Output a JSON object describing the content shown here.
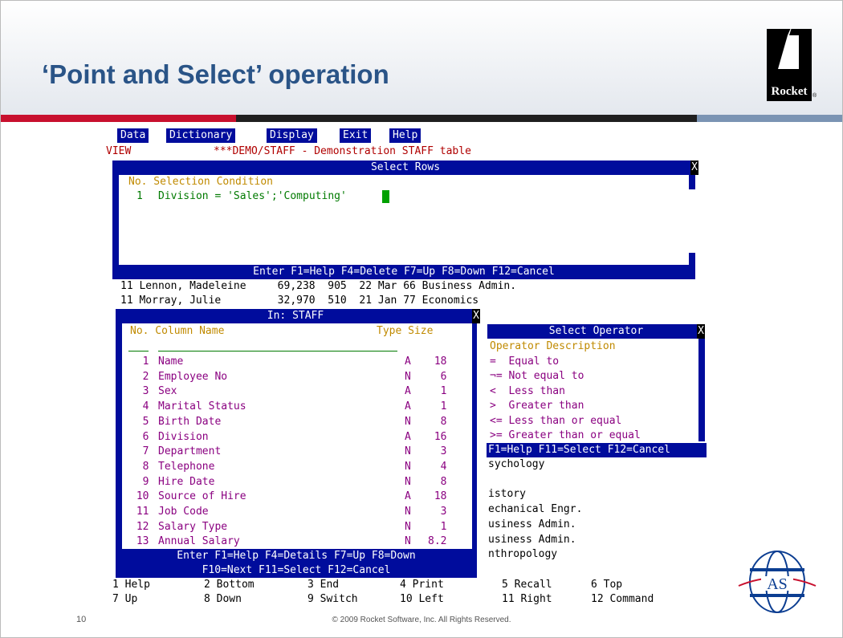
{
  "slide": {
    "title": "‘Point and Select’ operation",
    "page_number": "10",
    "copyright": "© 2009 Rocket Software, Inc. All Rights Reserved.",
    "logo_text": "Rocket",
    "logo_reg": "®",
    "badge_text": "AS"
  },
  "menu": [
    "Data",
    "Dictionary",
    "Display",
    "Exit",
    "Help"
  ],
  "view_label": "VIEW",
  "view_title": "***DEMO/STAFF - Demonstration STAFF table",
  "select_rows": {
    "title": "Select Rows",
    "close": "X",
    "header": "No. Selection Condition",
    "row_num": "1",
    "row_text": "Division = 'Sales';'Computing'",
    "footer": "Enter F1=Help F4=Delete F7=Up F8=Down F12=Cancel"
  },
  "data_rows": [
    "11 Lennon, Madeleine     69,238  905  22 Mar 66 Business Admin.",
    "11 Morray, Julie         32,970  510  21 Jan 77 Economics"
  ],
  "column_picker": {
    "title": "In: STAFF",
    "close": "X",
    "header_no_col": "No. Column Name",
    "header_type_size": "Type Size",
    "rows": [
      {
        "no": "1",
        "name": "Name",
        "type": "A",
        "size": "18"
      },
      {
        "no": "2",
        "name": "Employee No",
        "type": "N",
        "size": "6"
      },
      {
        "no": "3",
        "name": "Sex",
        "type": "A",
        "size": "1"
      },
      {
        "no": "4",
        "name": "Marital Status",
        "type": "A",
        "size": "1"
      },
      {
        "no": "5",
        "name": "Birth Date",
        "type": "N",
        "size": "8"
      },
      {
        "no": "6",
        "name": "Division",
        "type": "A",
        "size": "16"
      },
      {
        "no": "7",
        "name": "Department",
        "type": "N",
        "size": "3"
      },
      {
        "no": "8",
        "name": "Telephone",
        "type": "N",
        "size": "4"
      },
      {
        "no": "9",
        "name": "Hire Date",
        "type": "N",
        "size": "8"
      },
      {
        "no": "10",
        "name": "Source of Hire",
        "type": "A",
        "size": "18"
      },
      {
        "no": "11",
        "name": "Job Code",
        "type": "N",
        "size": "3"
      },
      {
        "no": "12",
        "name": "Salary Type",
        "type": "N",
        "size": "1"
      },
      {
        "no": "13",
        "name": "Annual Salary",
        "type": "N",
        "size": "8.2"
      }
    ],
    "footer1": "Enter F1=Help F4=Details F7=Up F8=Down",
    "footer2": "F10=Next F11=Select F12=Cancel"
  },
  "operator_picker": {
    "title": "Select Operator",
    "close": "X",
    "header": "Operator Description",
    "rows": [
      "=  Equal to",
      "¬= Not equal to",
      "<  Less than",
      ">  Greater than",
      "<= Less than or equal",
      ">= Greater than or equal"
    ],
    "footer": "F1=Help F11=Select F12=Cancel"
  },
  "background_right": [
    "sychology",
    "",
    "istory",
    "echanical Engr.",
    "usiness Admin.",
    "usiness Admin.",
    "nthropology"
  ],
  "fkeys_row1": [
    "1 Help",
    "2 Bottom",
    "3 End",
    "4 Print",
    "5 Recall",
    "6 Top"
  ],
  "fkeys_row2": [
    "7 Up",
    "8 Down",
    "9 Switch",
    "10 Left",
    "11 Right",
    "12 Command"
  ],
  "colors": {
    "title_blue": "#2a5487",
    "term_blue": "#000c9c",
    "bar_red": "#c8102e",
    "bar_dark": "#1f1f1f",
    "bar_steel": "#7b94b3"
  }
}
